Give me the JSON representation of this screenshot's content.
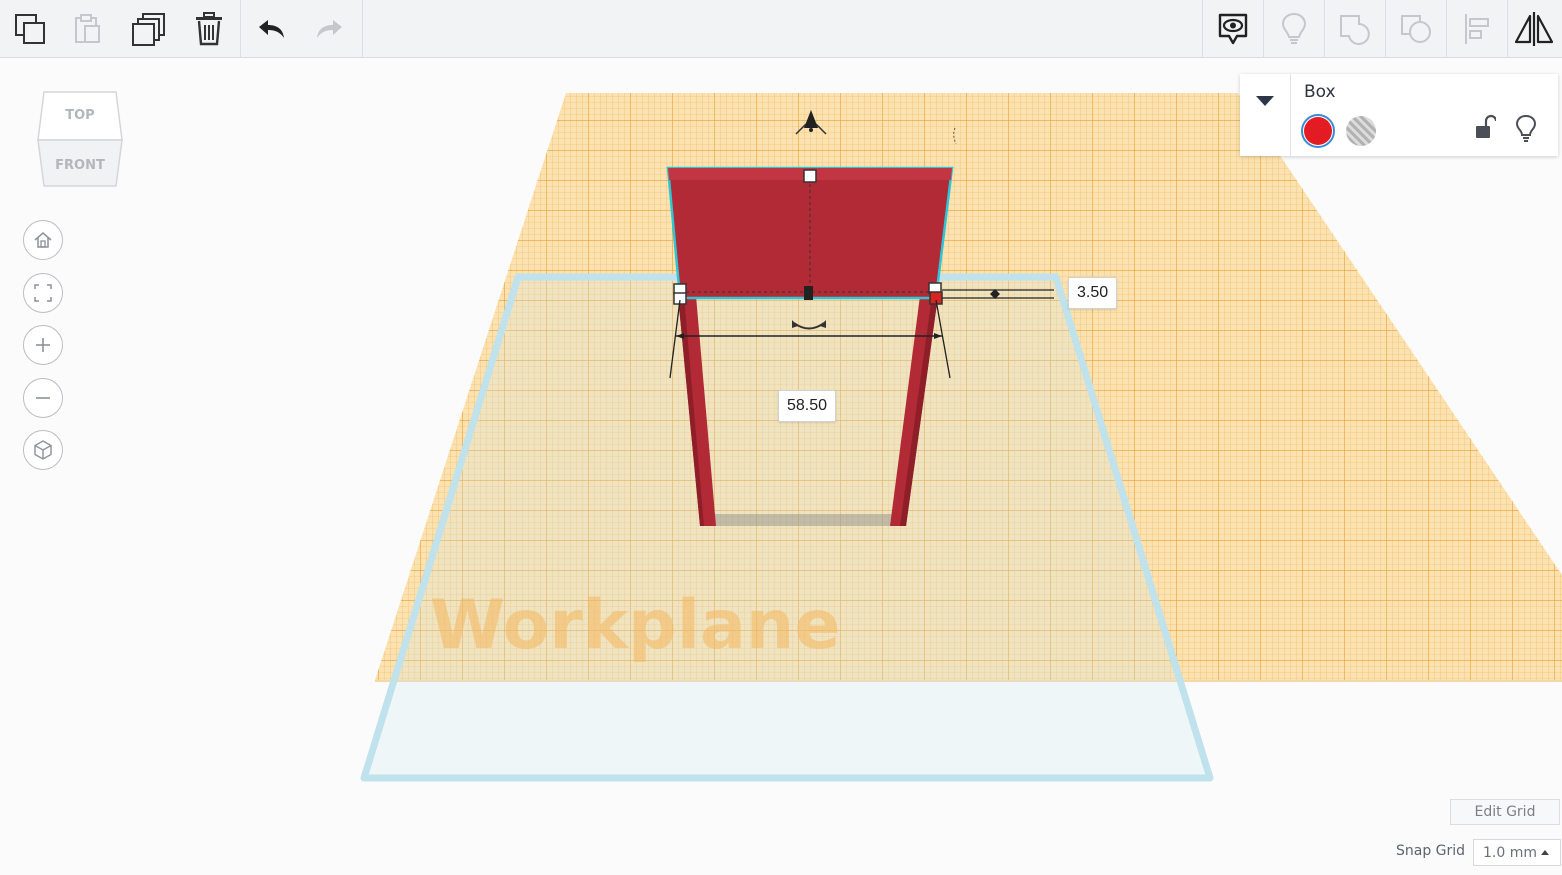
{
  "toolbar": {
    "left": [
      {
        "name": "copy-button",
        "icon": "copy-icon",
        "enabled": true
      },
      {
        "name": "paste-button",
        "icon": "paste-icon",
        "enabled": false
      },
      {
        "name": "duplicate-button",
        "icon": "duplicate-icon",
        "enabled": true
      },
      {
        "name": "delete-button",
        "icon": "trash-icon",
        "enabled": true
      },
      {
        "name": "undo-button",
        "icon": "undo-icon",
        "enabled": true
      },
      {
        "name": "redo-button",
        "icon": "redo-icon",
        "enabled": false
      }
    ],
    "right": [
      {
        "name": "notes-button",
        "icon": "eye-speech-bubble-icon",
        "enabled": true
      },
      {
        "name": "show-all-button",
        "icon": "lightbulb-icon",
        "enabled": false
      },
      {
        "name": "group-button",
        "icon": "group-icon",
        "enabled": false
      },
      {
        "name": "ungroup-button",
        "icon": "ungroup-icon",
        "enabled": false
      },
      {
        "name": "align-button",
        "icon": "align-icon",
        "enabled": false
      },
      {
        "name": "mirror-button",
        "icon": "mirror-icon",
        "enabled": true
      }
    ]
  },
  "viewcube": {
    "top": "TOP",
    "front": "FRONT"
  },
  "nav": [
    {
      "name": "home-view-button",
      "icon": "home-icon"
    },
    {
      "name": "fit-view-button",
      "icon": "fit-icon"
    },
    {
      "name": "zoom-in-button",
      "icon": "plus-icon"
    },
    {
      "name": "zoom-out-button",
      "icon": "minus-icon"
    },
    {
      "name": "perspective-button",
      "icon": "cube-icon"
    }
  ],
  "inspector": {
    "title": "Box",
    "solid_color": "#e31b23",
    "lock_icon": "unlock-icon",
    "light_icon": "lightbulb-icon"
  },
  "scene": {
    "workplane_label": "Workplane",
    "grid_color": "#f3b04a",
    "object_color": "#b22a35",
    "dimensions": {
      "width": "58.50",
      "depth": "3.50"
    }
  },
  "grid_controls": {
    "edit_grid": "Edit Grid",
    "snap_label": "Snap Grid",
    "snap_value": "1.0 mm"
  }
}
